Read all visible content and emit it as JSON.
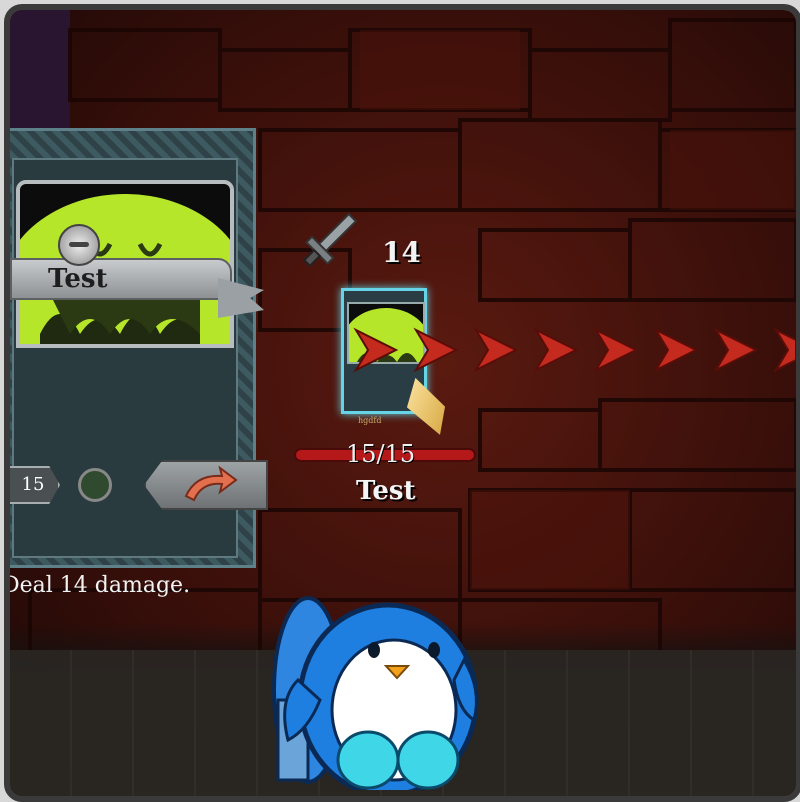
{
  "card": {
    "title": "Test",
    "cost": "15",
    "description": "Deal 14 damage.",
    "icons": [
      "slime-art",
      "gem-icon",
      "redirect-arrow-icon",
      "sword-icon"
    ]
  },
  "enemy": {
    "intent_value": "14",
    "hp_text": "15/15",
    "hp_fraction": 1.0,
    "name": "Test",
    "card_caption": "hgdfd"
  },
  "colors": {
    "hp_bar": "#b41818",
    "enemy_card_glow": "#66d4e6",
    "slime": "#b6e62a",
    "targeting_arrow": "#c42a1e",
    "penguin_blue": "#1f7fe0"
  }
}
